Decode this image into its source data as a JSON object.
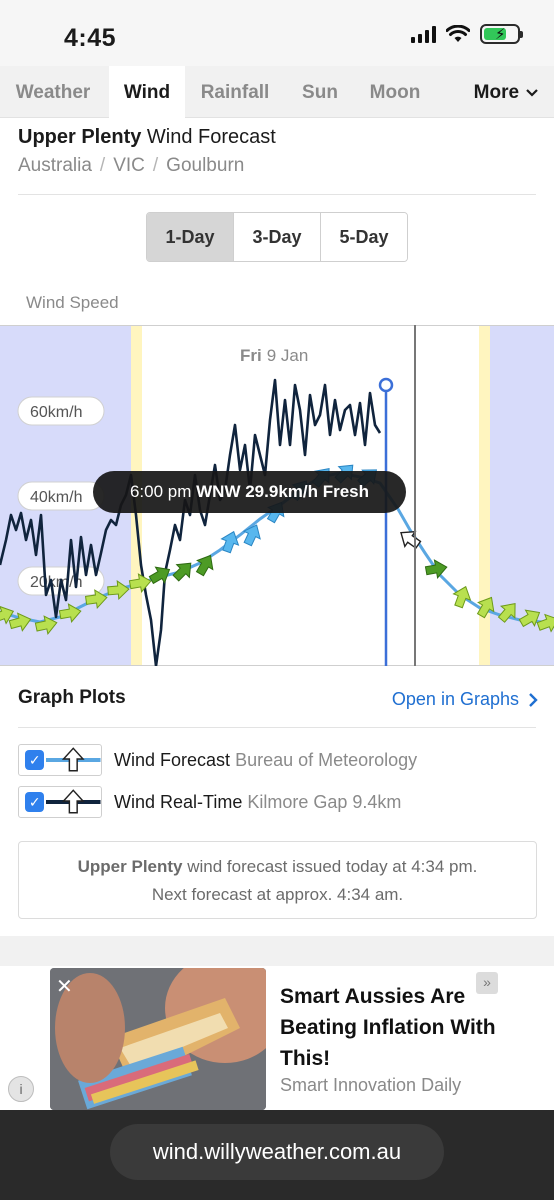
{
  "status": {
    "time": "4:45"
  },
  "tabs": [
    {
      "label": "Weather"
    },
    {
      "label": "Wind"
    },
    {
      "label": "Rainfall"
    },
    {
      "label": "Sun"
    },
    {
      "label": "Moon"
    },
    {
      "label": "More"
    }
  ],
  "active_tab": "Wind",
  "title": {
    "location": "Upper Plenty",
    "suffix": "Wind Forecast"
  },
  "breadcrumb": [
    "Australia",
    "VIC",
    "Goulburn"
  ],
  "range_options": [
    "1-Day",
    "3-Day",
    "5-Day"
  ],
  "range_selected": "1-Day",
  "chart_label": "Wind Speed",
  "chart": {
    "day_label_bold": "Fri",
    "day_label_date": "9 Jan",
    "y_labels": [
      "60km/h",
      "40km/h",
      "20km/h"
    ],
    "tooltip_time": "6:00 pm",
    "tooltip_value": "WNW 29.9km/h Fresh"
  },
  "graph_plots": {
    "title": "Graph Plots",
    "link": "Open in Graphs",
    "items": [
      {
        "name": "Wind Forecast",
        "source": "Bureau of Meteorology",
        "checked": true
      },
      {
        "name": "Wind Real-Time",
        "source": "Kilmore Gap 9.4km",
        "checked": true
      }
    ]
  },
  "forecast_info": {
    "location": "Upper Plenty",
    "line1_rest": "wind forecast issued today at 4:34 pm.",
    "line2": "Next forecast at approx. 4:34 am."
  },
  "ad": {
    "headline": "Smart Aussies Are Beating Inflation With This!",
    "source": "Smart Innovation Daily"
  },
  "url": "wind.willyweather.com.au",
  "colors": {
    "night": "#d7dbfa",
    "twilight": "#fff5bf",
    "forecast_line": "#5aa7e2",
    "realtime_line": "#10243d",
    "now_line": "#3b6fd8",
    "accent_link": "#1f6fd1"
  }
}
